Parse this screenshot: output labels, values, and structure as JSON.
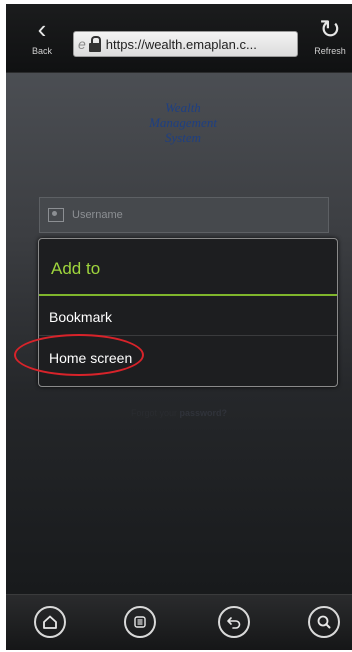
{
  "topbar": {
    "back_label": "Back",
    "refresh_label": "Refresh",
    "url": "https://wealth.emaplan.c..."
  },
  "page": {
    "brand_lines": [
      "Wealth",
      "Management",
      "System"
    ],
    "username_placeholder": "Username",
    "forgot_prefix": "Forgot your ",
    "forgot_bold": "password?"
  },
  "dialog": {
    "title": "Add to",
    "items": [
      {
        "label": "Bookmark"
      },
      {
        "label": "Home screen"
      }
    ],
    "accent_color": "#9fd53d",
    "highlight_color": "#d8232a"
  },
  "bottombar": {
    "icons": [
      "home-icon",
      "menu-icon",
      "back-arrow-icon",
      "search-icon"
    ]
  }
}
